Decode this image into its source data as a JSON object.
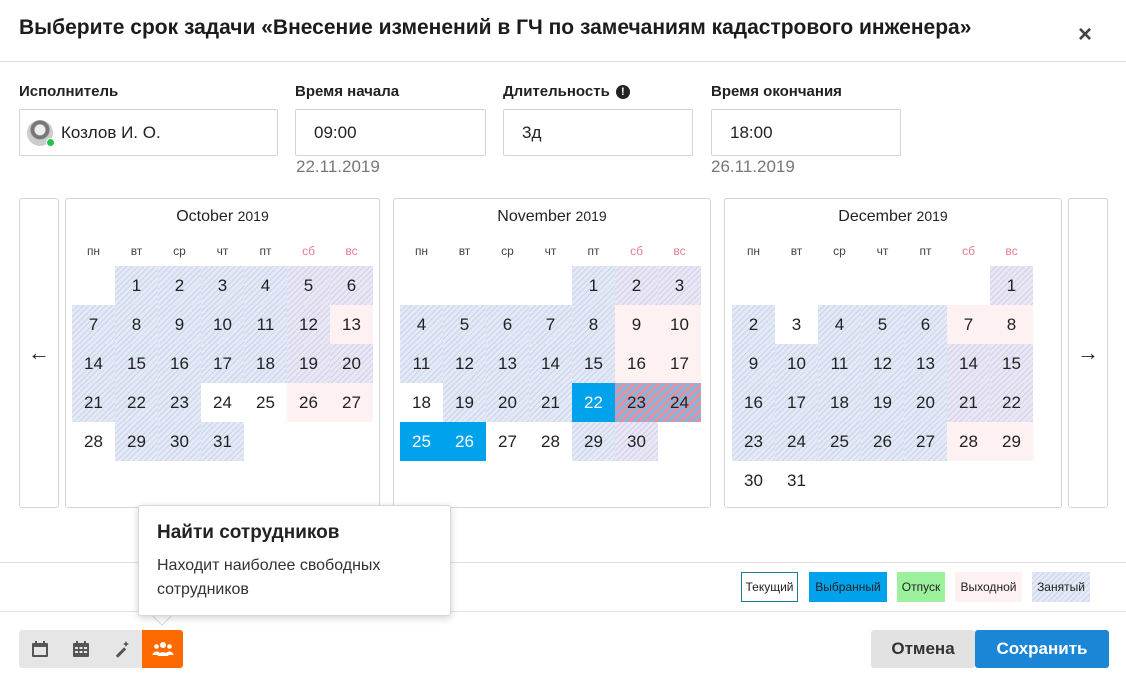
{
  "dialog": {
    "title": "Выберите срок задачи «Внесение изменений в ГЧ по замечаниям кадастрового инженера»",
    "close": "×"
  },
  "fields": {
    "assignee": {
      "label": "Исполнитель",
      "value": "Козлов И. О."
    },
    "start": {
      "label": "Время начала",
      "value": "09:00",
      "date": "22.11.2019"
    },
    "duration": {
      "label": "Длительность",
      "value": "3д",
      "info_icon": "!"
    },
    "end": {
      "label": "Время окончания",
      "value": "18:00",
      "date": "26.11.2019"
    }
  },
  "nav": {
    "prev": "←",
    "next": "→"
  },
  "weekdays": [
    "пн",
    "вт",
    "ср",
    "чт",
    "пт",
    "сб",
    "вс"
  ],
  "months": [
    {
      "name": "October",
      "year": "2019",
      "offset": 1,
      "days": 31,
      "busy": [
        1,
        2,
        3,
        4,
        5,
        6,
        7,
        8,
        9,
        10,
        11,
        12,
        14,
        15,
        16,
        17,
        18,
        19,
        20,
        21,
        22,
        23,
        29,
        30,
        31
      ],
      "selected": [],
      "selected_busy": []
    },
    {
      "name": "November",
      "year": "2019",
      "offset": 4,
      "days": 30,
      "busy": [
        1,
        2,
        3,
        4,
        5,
        6,
        7,
        8,
        11,
        12,
        13,
        14,
        15,
        19,
        20,
        21,
        29,
        30
      ],
      "selected": [
        22,
        25,
        26
      ],
      "selected_busy": [
        23,
        24
      ]
    },
    {
      "name": "December",
      "year": "2019",
      "offset": 6,
      "days": 31,
      "busy": [
        1,
        2,
        4,
        5,
        6,
        9,
        10,
        11,
        12,
        13,
        14,
        15,
        16,
        17,
        18,
        19,
        20,
        21,
        22,
        23,
        24,
        25,
        26,
        27
      ],
      "selected": [],
      "selected_busy": []
    }
  ],
  "legend": [
    {
      "label": "Текущий",
      "kind": "current"
    },
    {
      "label": "Выбранный",
      "kind": "selected",
      "color": "#00a2ec"
    },
    {
      "label": "Отпуск",
      "kind": "vacation",
      "color": "#9cf29c"
    },
    {
      "label": "Выходной",
      "kind": "weekend",
      "color": "#fdf1f1"
    },
    {
      "label": "Занятый",
      "kind": "busy"
    }
  ],
  "tooltip": {
    "title": "Найти сотрудников",
    "text": "Находит наиболее свободных сотрудников"
  },
  "toolbar": [
    {
      "icon": "calendar-icon",
      "active": false
    },
    {
      "icon": "calendar-grid-icon",
      "active": false
    },
    {
      "icon": "magic-wand-icon",
      "active": false
    },
    {
      "icon": "people-icon",
      "active": true
    }
  ],
  "buttons": {
    "cancel": "Отмена",
    "save": "Сохранить"
  },
  "colors": {
    "selected": "#00a2ec",
    "save": "#1c86d6",
    "active_tool": "#fe6a00",
    "weekend_text": "#e87b8f"
  }
}
